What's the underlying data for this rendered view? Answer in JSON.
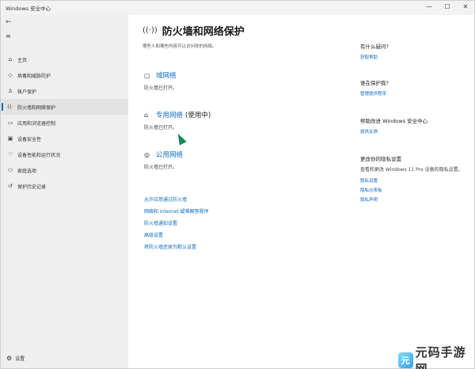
{
  "window": {
    "title": "Windows 安全中心",
    "controls": {
      "minimize": "—",
      "maximize": "☐",
      "close": "✕"
    }
  },
  "sidebar": {
    "back_icon": "←",
    "menu_icon": "≡",
    "items": [
      {
        "label": "主页",
        "icon": "⌂",
        "active": false
      },
      {
        "label": "病毒和威胁防护",
        "icon": "◇",
        "active": false
      },
      {
        "label": "帐户保护",
        "icon": "♙",
        "active": false
      },
      {
        "label": "防火墙和网络保护",
        "icon": "((·",
        "active": true
      },
      {
        "label": "应用和浏览器控制",
        "icon": "▭",
        "active": false
      },
      {
        "label": "设备安全性",
        "icon": "▣",
        "active": false
      },
      {
        "label": "设备性能和运行状况",
        "icon": "♡",
        "active": false
      },
      {
        "label": "家庭选项",
        "icon": "⚇",
        "active": false
      },
      {
        "label": "保护历史记录",
        "icon": "↺",
        "active": false
      }
    ],
    "settings": {
      "label": "设置",
      "icon": "⚙"
    }
  },
  "main": {
    "header_icon": "((·))",
    "title": "防火墙和网络保护",
    "description": "哪些人和哪些内容可以访问你的网络。",
    "networks": [
      {
        "icon": "▢",
        "name": "域网络",
        "suffix": "",
        "status": "防火墙已打开。"
      },
      {
        "icon": "⌂",
        "name": "专用网络",
        "suffix": "(使用中)",
        "status": "防火墙已打开。"
      },
      {
        "icon": "◎",
        "name": "公用网络",
        "suffix": "",
        "status": "防火墙已打开。"
      }
    ],
    "links": [
      "允许应用通过防火墙",
      "网络和 Internet 疑难解答程序",
      "防火墙通知设置",
      "高级设置",
      "将防火墙还原为默认设置"
    ]
  },
  "right_panel": {
    "question": {
      "title": "有什么疑问?",
      "link": "获取帮助"
    },
    "protect": {
      "title": "谁在保护我?",
      "link": "管理提供程序"
    },
    "improve": {
      "title": "帮助改进 Windows 安全中心",
      "link": "提供反馈"
    },
    "privacy": {
      "title": "更改你的隐私设置",
      "text": "查看和更改 Windows 11 Pro 设备的隐私设置。",
      "links": [
        "隐私设置",
        "隐私仪表板",
        "隐私声明"
      ]
    }
  },
  "watermark": {
    "logo_char": "元",
    "text": "元码手游网"
  },
  "colors": {
    "accent": "#0f6cbd",
    "sidebar_bg": "#efefef",
    "cursor": "#168a55"
  }
}
